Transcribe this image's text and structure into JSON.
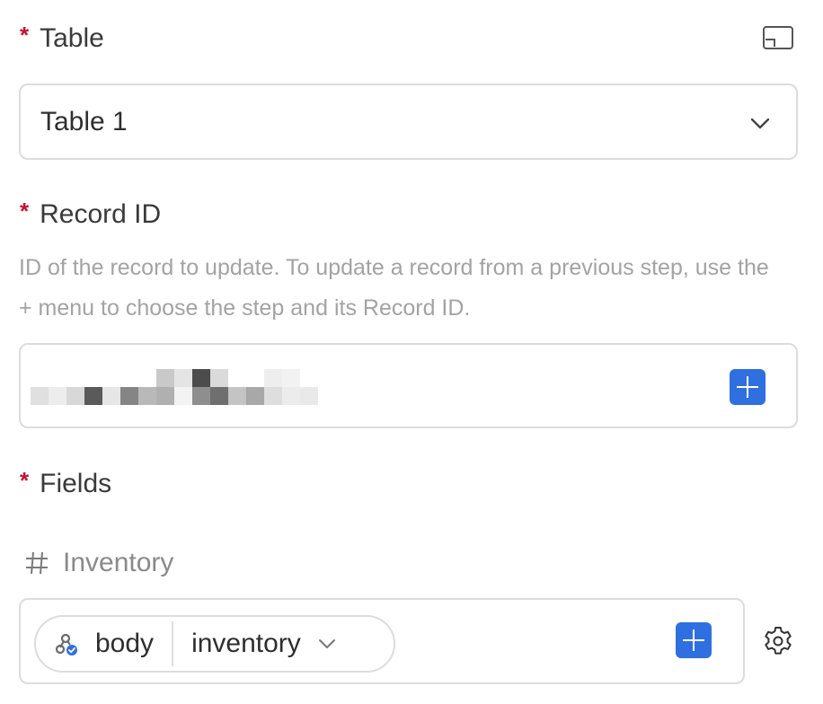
{
  "table": {
    "required_marker": "*",
    "label": "Table",
    "selected": "Table 1",
    "expand_icon": "expand-icon",
    "chevron_icon": "chevron-down-icon"
  },
  "record_id": {
    "required_marker": "*",
    "label": "Record ID",
    "help": "ID of the record to update. To update a record from a previous step, use the + menu to choose the step and its Record ID.",
    "value_redacted": true,
    "plus_icon": "plus-icon"
  },
  "fields": {
    "required_marker": "*",
    "label": "Fields",
    "items": [
      {
        "type_icon": "hash-icon",
        "name": "Inventory",
        "token": {
          "icon": "webhook-icon",
          "source": "body",
          "path": "inventory"
        }
      }
    ],
    "gear_icon": "gear-icon"
  },
  "colors": {
    "accent": "#2f6fe0",
    "required": "#c8102e",
    "border": "#dcdcdc",
    "help_text": "#a3a3a3"
  }
}
